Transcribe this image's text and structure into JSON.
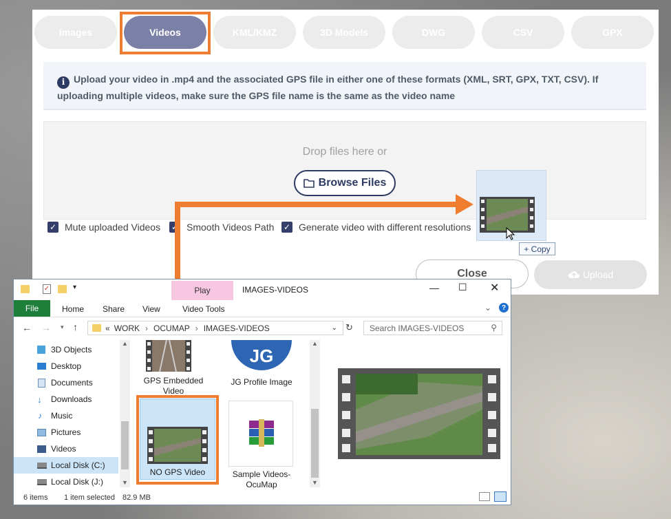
{
  "tabs": [
    {
      "label": "Images"
    },
    {
      "label": "Videos"
    },
    {
      "label": "KML/KMZ"
    },
    {
      "label": "3D Models"
    },
    {
      "label": "DWG"
    },
    {
      "label": "CSV"
    },
    {
      "label": "GPX"
    }
  ],
  "info": {
    "text": "Upload your video in .mp4 and the associated GPS file in either one of these formats (XML, SRT, GPX, TXT, CSV). If uploading multiple videos, make sure the GPS file name is the same as the video name"
  },
  "dropzone": {
    "text": "Drop files here or",
    "browse_label": "Browse Files"
  },
  "options": {
    "mute": "Mute uploaded Videos",
    "smooth": "Smooth Videos Path",
    "resolutions": "Generate video with different resolutions"
  },
  "buttons": {
    "close": "Close",
    "upload": "Upload"
  },
  "drag": {
    "copy_label": "+ Copy"
  },
  "explorer": {
    "context_tab": "Play",
    "title": "IMAGES-VIDEOS",
    "ribbon": [
      "File",
      "Home",
      "Share",
      "View",
      "Video Tools"
    ],
    "breadcrumb": [
      "WORK",
      "OCUMAP",
      "IMAGES-VIDEOS"
    ],
    "search_placeholder": "Search IMAGES-VIDEOS",
    "nav": [
      "3D Objects",
      "Desktop",
      "Documents",
      "Downloads",
      "Music",
      "Pictures",
      "Videos",
      "Local Disk (C:)",
      "Local Disk (J:)"
    ],
    "files": [
      "GPS Embedded Video",
      "JG Profile Image",
      "NO GPS Video",
      "Sample Videos-OcuMap"
    ],
    "status": {
      "items": "6 items",
      "selected": "1 item selected",
      "size": "82.9 MB"
    }
  },
  "colors": {
    "accent": "#ef7d2f",
    "brand": "#2d3a63",
    "active_tab": "#7a80a6"
  }
}
